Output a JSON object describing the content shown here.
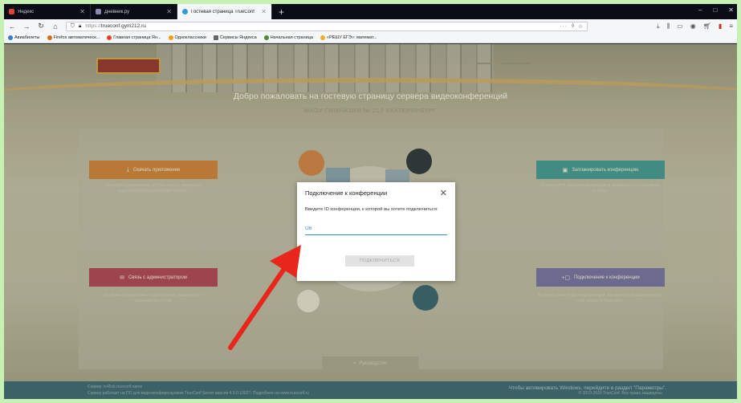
{
  "browser": {
    "tabs": [
      {
        "label": "Яндекс",
        "active": false
      },
      {
        "label": "Дневник.ру",
        "active": false
      },
      {
        "label": "Гостевая страница TrueConf",
        "active": true
      }
    ],
    "new_tab": "+",
    "window_controls": [
      "–",
      "□",
      "✕"
    ],
    "url_protocol": "https://",
    "url_host": "trueconf.gym212.ru",
    "url_menu": "···",
    "bookmarks": [
      "Авиабилеты",
      "Firefox автоматическ...",
      "Главная страница Ян...",
      "Одноклассники",
      "Сервисы Яндекса",
      "Начальная страница",
      "«РЕШУ ЕГЭ»: математ..."
    ]
  },
  "page": {
    "welcome_title": "Добро пожаловать на гостевую страницу сервера видеоконференций",
    "welcome_subtitle": "МАОУ ГИМНАЗИЯ № 212 ЕКАТЕРИНБУРГ",
    "actions": {
      "download": {
        "label": "Скачать приложение",
        "desc": "Скачайте приложение, чтобы начать проводить видеоконференции прямо сейчас."
      },
      "schedule": {
        "label": "Запланировать конференцию",
        "desc": "Планируйте видеоконференции и вебинары со входом по ссылке."
      },
      "contact": {
        "label": "Связь с администратором",
        "desc": "Если вы столкнулись с проблемой, свяжитесь с администратором."
      },
      "join": {
        "label": "Подключение к конференции",
        "desc": "Если вы знаете ID конференции, вы можете подключиться к ней прямо в браузере."
      }
    },
    "manual_label": "Руководство"
  },
  "footer": {
    "server": "Сервер: tc45vb.trueconf.name",
    "info": "Сервер работает на ПО для видеоконференцсвязи TrueConf Server версии 4.5.0.10027. Подробнее на www.trueconf.ru",
    "copyright": "© 2010-2020 TrueConf. Все права защищены."
  },
  "windows_watermark": "Чтобы активировать Windows, перейдите в раздел \"Параметры\".",
  "modal": {
    "title": "Подключение к конференции",
    "close": "✕",
    "prompt": "Введите ID конференции, к которой вы хотите подключиться:",
    "input_value": "OB",
    "connect_button": "ПОДКЛЮЧИТЬСЯ"
  },
  "colors": {
    "page_background": "#c6f0b4",
    "input_accent": "#3a8fd1",
    "arrow": "#e8261c"
  }
}
